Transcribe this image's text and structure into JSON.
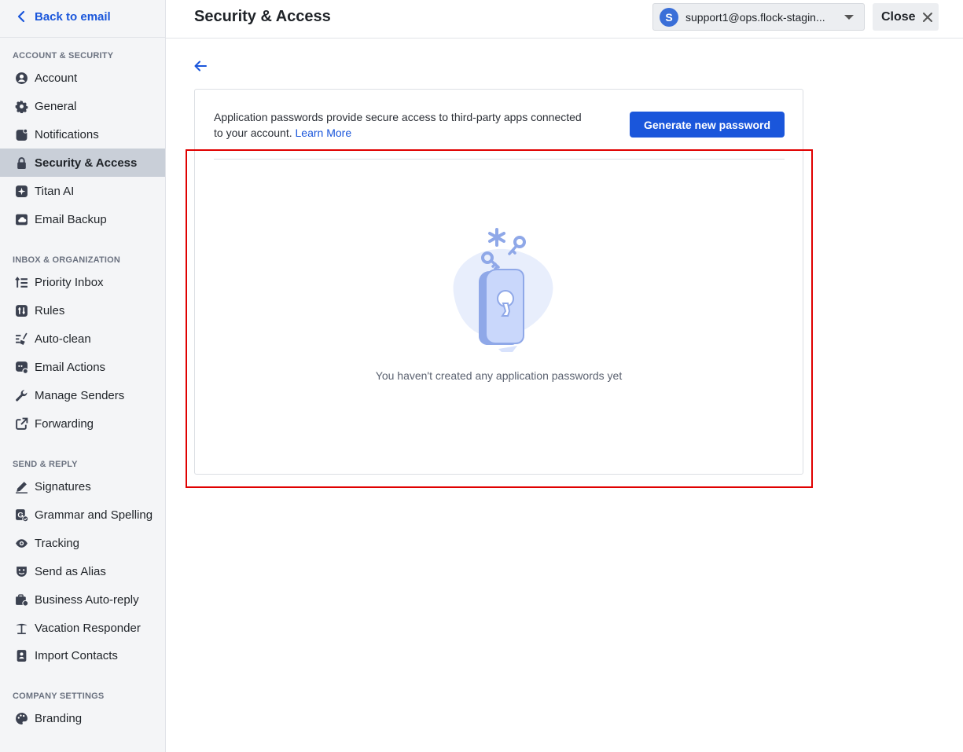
{
  "sidebar": {
    "back_label": "Back to email",
    "sections": {
      "account_security": "ACCOUNT & SECURITY",
      "inbox_organization": "INBOX & ORGANIZATION",
      "send_reply": "SEND & REPLY",
      "company_settings": "COMPANY SETTINGS"
    },
    "items": {
      "account": "Account",
      "general": "General",
      "notifications": "Notifications",
      "security": "Security & Access",
      "titan_ai": "Titan AI",
      "email_backup": "Email Backup",
      "priority_inbox": "Priority Inbox",
      "rules": "Rules",
      "auto_clean": "Auto-clean",
      "email_actions": "Email Actions",
      "manage_senders": "Manage Senders",
      "forwarding": "Forwarding",
      "signatures": "Signatures",
      "grammar": "Grammar and Spelling",
      "tracking": "Tracking",
      "send_alias": "Send as Alias",
      "business_autoreply": "Business Auto-reply",
      "vacation": "Vacation Responder",
      "import_contacts": "Import Contacts",
      "branding": "Branding"
    },
    "active_item": "security"
  },
  "header": {
    "title": "Security & Access",
    "avatar_initial": "S",
    "account_email": "support1@ops.flock-stagin...",
    "close_label": "Close"
  },
  "card": {
    "description": "Application passwords provide secure access to third-party apps connected to your account.",
    "learn_more": "Learn More",
    "generate_button": "Generate new password",
    "empty_state": "You haven't created any application passwords yet"
  },
  "colors": {
    "accent": "#1a56db",
    "sidebar_bg": "#f4f5f7",
    "active_bg": "#c9cfd8",
    "highlight": "#e00000",
    "illustration": "#8fa8e8"
  }
}
